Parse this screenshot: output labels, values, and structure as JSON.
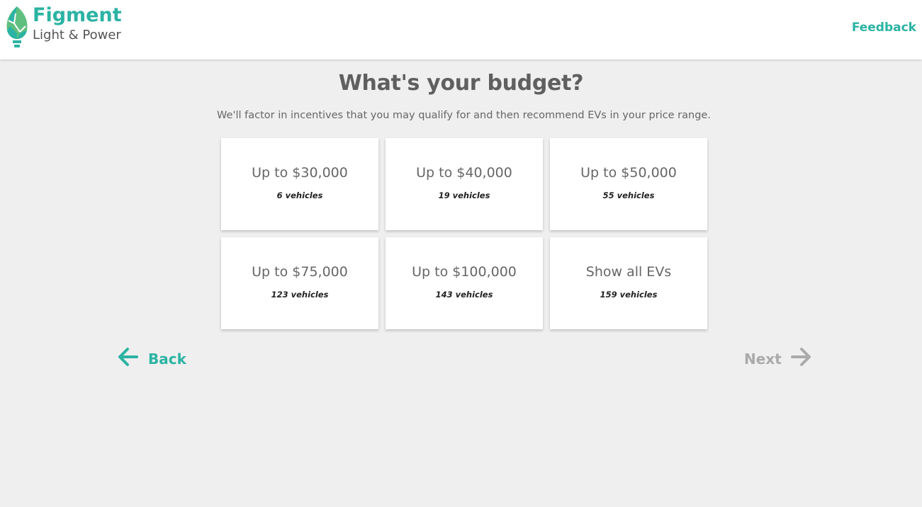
{
  "header": {
    "logo": {
      "name": "Figment",
      "subtitle": "Light & Power",
      "icon": "leaf-bulb-icon"
    },
    "feedback_label": "Feedback"
  },
  "main": {
    "title": "What's your budget?",
    "subtitle": "We'll factor in incentives that you may qualify for and then recommend EVs in your price range.",
    "options": [
      {
        "label": "Up to $30,000",
        "count": "6 vehicles"
      },
      {
        "label": "Up to $40,000",
        "count": "19 vehicles"
      },
      {
        "label": "Up to $50,000",
        "count": "55 vehicles"
      },
      {
        "label": "Up to $75,000",
        "count": "123 vehicles"
      },
      {
        "label": "Up to $100,000",
        "count": "143 vehicles"
      },
      {
        "label": "Show all EVs",
        "count": "159 vehicles"
      }
    ]
  },
  "navigation": {
    "back_label": "Back",
    "back_icon": "arrow-left-icon",
    "next_label": "Next",
    "next_icon": "arrow-right-icon",
    "next_enabled": false
  },
  "colors": {
    "brand": "#2bb3a3",
    "leaf_light": "#5fbf7f",
    "disabled": "#aaaaaa",
    "background": "#efefef"
  }
}
